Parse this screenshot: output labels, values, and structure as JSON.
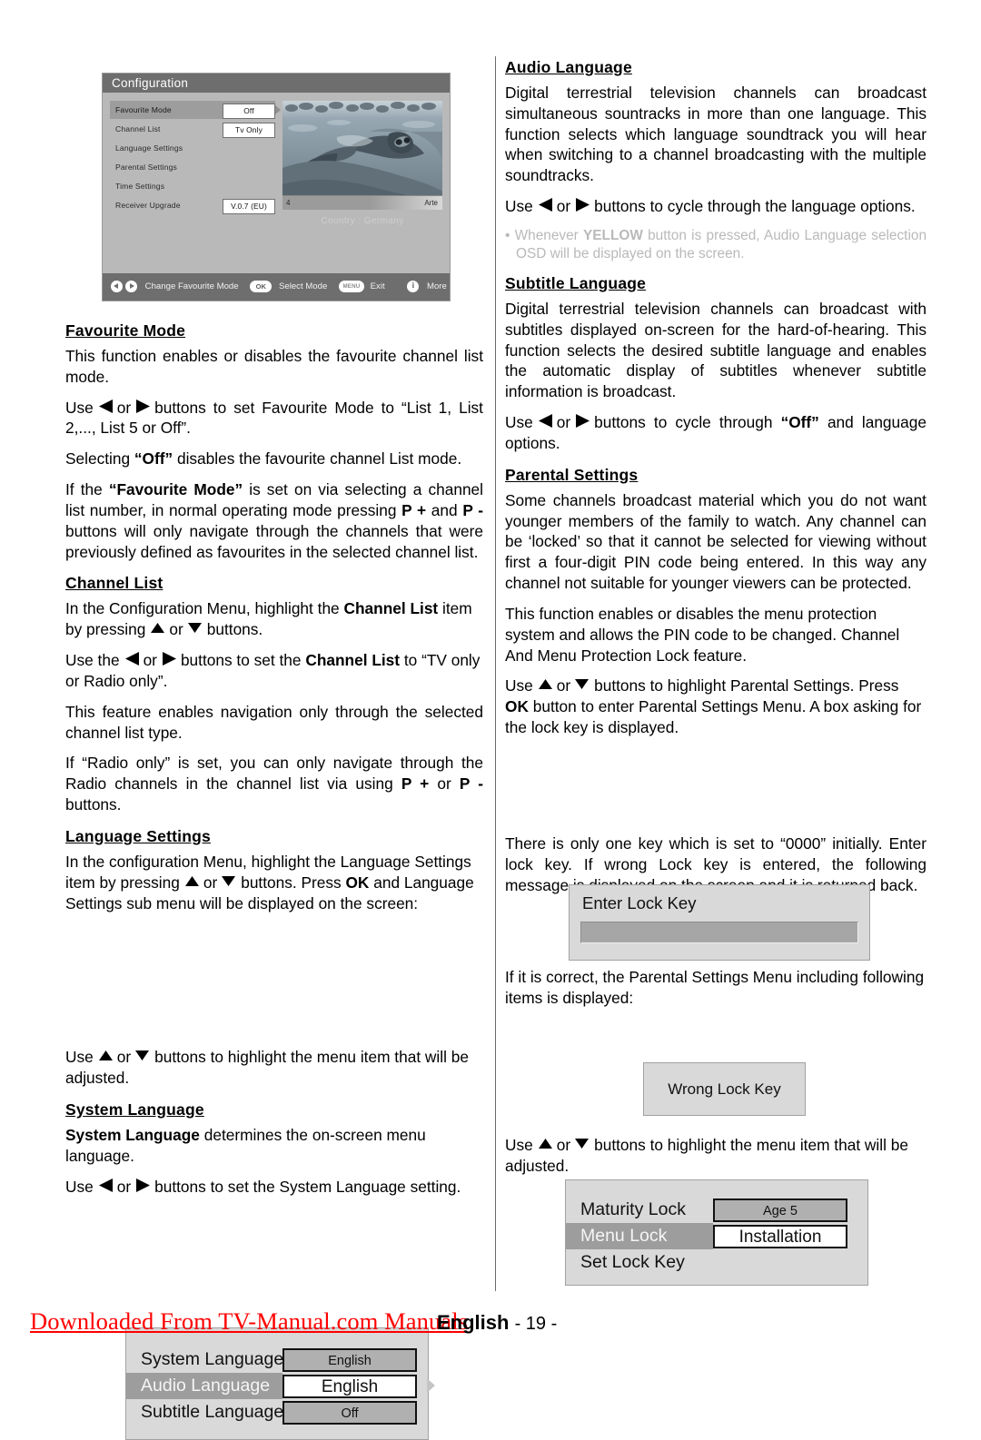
{
  "osd_screenshot": {
    "title": "Configuration",
    "rows": [
      {
        "label": "Favourite Mode",
        "value": "Off",
        "selected": true,
        "caret": true
      },
      {
        "label": "Channel List",
        "value": "Tv Only",
        "selected": false,
        "caret": false
      },
      {
        "label": "Language Settings",
        "value": "",
        "selected": false,
        "caret": false
      },
      {
        "label": "Parental Settings",
        "value": "",
        "selected": false,
        "caret": false
      },
      {
        "label": "Time Settings",
        "value": "",
        "selected": false,
        "caret": false
      },
      {
        "label": "Receiver Upgrade",
        "value": "V.0.7 (EU)",
        "selected": false,
        "caret": false
      }
    ],
    "preview": {
      "channel_number": "4",
      "channel_name": "Arte",
      "country": "Country :  Germany"
    },
    "footer": {
      "change_label": "Change Favourite Mode",
      "ok_badge": "OK",
      "ok_label": "Select Mode",
      "menu_badge": "MENU",
      "menu_label": "Exit",
      "info_badge": "i",
      "info_label": "More"
    }
  },
  "left_column": {
    "favourite_mode": {
      "heading": "Favourite Mode",
      "p1": "This function enables or disables the favourite channel list mode.",
      "p2_a": "Use",
      "p2_b": "or",
      "p2_c": "buttons to set Favourite Mode to “List 1, List 2,..., List 5 or Off”.",
      "p3_a": "Selecting",
      "p3_b": "“Off”",
      "p3_c": "disables the favourite channel List mode.",
      "p4_a": "If the",
      "p4_b": "“Favourite Mode”",
      "p4_c": "is set on via selecting a channel list number, in normal operating mode pressing",
      "p4_d": "P +",
      "p4_e": "and",
      "p4_f": "P -",
      "p4_g": "buttons will only navigate  through the channels that were previously defined as favourites in the selected channel list."
    },
    "channel_list": {
      "heading": "Channel List",
      "p1_a": "In the Configuration Menu, highlight the",
      "p1_b": "Channel List",
      "p1_c": "item by pressing",
      "p1_d": "or",
      "p1_e": "buttons.",
      "p2_a": "Use the",
      "p2_b": "or",
      "p2_c": "buttons to set the",
      "p2_d": "Channel List",
      "p2_e": "to “TV only or Radio only”.",
      "p3": "This feature enables navigation only through the selected channel list type.",
      "p4_a": "If “Radio only” is set, you can only navigate through the Radio channels in the channel list via using",
      "p4_b": "P +",
      "p4_c": "or",
      "p4_d": "P -",
      "p4_e": "buttons."
    },
    "language_settings": {
      "heading": "Language Settings",
      "p1_a": "In the configuration Menu, highlight the Language Settings item by pressing",
      "p1_b": "or",
      "p1_c": "buttons. Press",
      "p1_d": "OK",
      "p1_e": "and Language Settings sub menu will be displayed on the screen:",
      "menu": {
        "rows": [
          {
            "label": "System Language",
            "value": "English",
            "selected": false,
            "white": false,
            "caret": false
          },
          {
            "label": "Audio Language",
            "value": "English",
            "selected": true,
            "white": true,
            "caret": true
          },
          {
            "label": "Subtitle Language",
            "value": "Off",
            "selected": false,
            "white": false,
            "caret": false
          }
        ]
      },
      "p2_a": "Use",
      "p2_b": "or",
      "p2_c": "buttons to highlight the menu item that will be adjusted."
    },
    "system_language": {
      "heading": "System Language",
      "p1_a": "System Language",
      "p1_b": "determines the on-screen menu language.",
      "p2_a": "Use",
      "p2_b": "or",
      "p2_c": "buttons to set the System Language setting."
    }
  },
  "right_column": {
    "audio_language": {
      "heading": "Audio Language",
      "p1": "Digital terrestrial television channels can broadcast simultaneous sountracks in more than one language. This function selects which language soundtrack you will hear when switching to a channel broadcasting with the multiple soundtracks.",
      "p2_a": "Use",
      "p2_b": "or",
      "p2_c": "buttons to cycle through the language options.",
      "note_a": "• Whenever",
      "note_b": "YELLOW",
      "note_c": "button is pressed, Audio Language selection OSD will be displayed on the screen."
    },
    "subtitle_language": {
      "heading": "Subtitle Language",
      "p1": "Digital terrestrial television channels can broadcast with subtitles displayed on-screen for the hard-of-hearing. This function selects the desired subtitle language and enables the automatic display of subtitles whenever subtitle information is broadcast.",
      "p2_a": "Use",
      "p2_b": "or",
      "p2_c": "buttons to cycle through",
      "p2_d": "“Off”",
      "p2_e": "and language options."
    },
    "parental_settings": {
      "heading": "Parental Settings",
      "p1": "Some channels broadcast material which you do not want younger members of the family to watch. Any channel can be ‘locked’ so that it cannot be selected for viewing without first a four-digit PIN code being entered. In this way any channel not suitable for younger viewers can be protected.",
      "p2": "This function enables or disables the menu protection system and allows the PIN code to be changed. Channel And Menu Protection Lock feature.",
      "p3_a": "Use",
      "p3_b": "or",
      "p3_c": "buttons to highlight Parental Settings. Press",
      "p3_d": "OK",
      "p3_e": "button to enter Parental Settings Menu.  A box asking for the lock key is displayed.",
      "enter_lock_key": {
        "title": "Enter Lock Key",
        "value": ""
      },
      "p4": "There is only one key which is set to “0000” initially. Enter lock key. If wrong Lock key is entered, the following message is displayed on the screen and it is returned back.",
      "wrong_lock_key": {
        "label": "Wrong Lock Key"
      },
      "p5": "If it is correct, the Parental Settings Menu including following items is displayed:",
      "menu": {
        "rows": [
          {
            "label": "Maturity Lock",
            "value": "Age 5",
            "selected": false,
            "white": false
          },
          {
            "label": "Menu Lock",
            "value": "Installation",
            "selected": true,
            "white": true
          },
          {
            "label": "Set Lock Key",
            "value": "",
            "selected": false,
            "white": false
          }
        ]
      },
      "p6_a": "Use",
      "p6_b": "or",
      "p6_c": "buttons to highlight the menu item that will be adjusted."
    }
  },
  "footer": {
    "download_note": "Downloaded From TV-Manual.com Manuals",
    "language": "English",
    "page_number": "- 19 -"
  },
  "colors": {
    "download_note_red": "#ff0000",
    "osd_header_gray": "#6e6e6e",
    "osd_body_gray": "#b9b9b9",
    "dialog_gray": "#d9d9d9",
    "selected_row_gray": "#9d9d9d",
    "note_text_gray": "#b9b9b9"
  }
}
